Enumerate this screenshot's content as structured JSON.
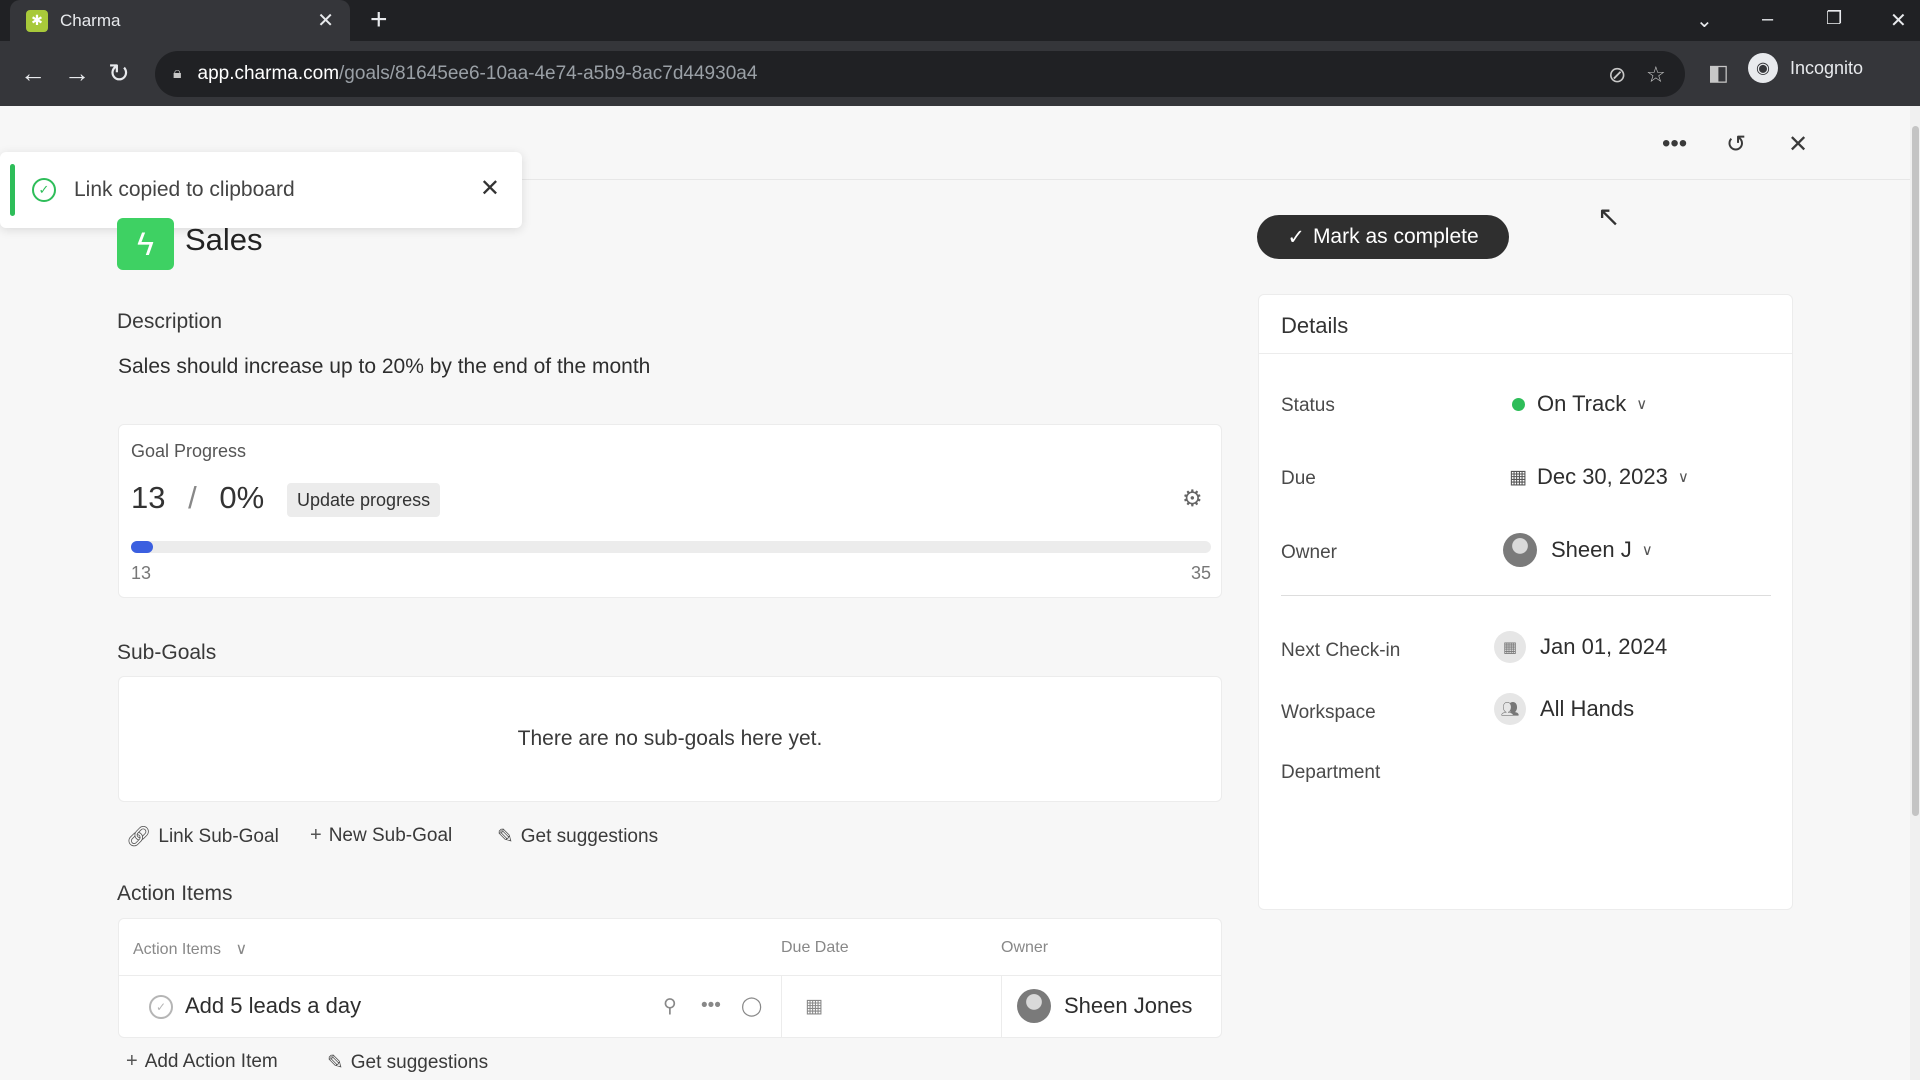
{
  "browser": {
    "tab_title": "Charma",
    "url_host": "app.charma.com",
    "url_path": "/goals/81645ee6-10aa-4e74-a5b9-8ac7d44930a4",
    "profile_label": "Incognito"
  },
  "toast": {
    "message": "Link copied to clipboard"
  },
  "goal": {
    "title": "Sales",
    "icon": "lightning-icon",
    "description_label": "Description",
    "description": "Sales should increase up to 20% by the end of the month"
  },
  "progress": {
    "title": "Goal Progress",
    "current": "13",
    "separator": "/",
    "percent": "0%",
    "update_label": "Update progress",
    "min_label": "13",
    "max_label": "35",
    "fill_fraction": 0.0
  },
  "subgoals": {
    "heading": "Sub-Goals",
    "empty_message": "There are no sub-goals here yet.",
    "actions": {
      "link": "Link Sub-Goal",
      "new": "New Sub-Goal",
      "suggest": "Get suggestions"
    }
  },
  "action_items": {
    "heading": "Action Items",
    "columns": {
      "name": "Action Items",
      "due": "Due Date",
      "owner": "Owner"
    },
    "rows": [
      {
        "name": "Add 5 leads a day",
        "owner": "Sheen Jones"
      }
    ],
    "add_label": "Add Action Item",
    "suggest_label": "Get suggestions"
  },
  "mark_complete_label": "Mark as complete",
  "details": {
    "title": "Details",
    "status_label": "Status",
    "status_value": "On Track",
    "status_color": "#2ebd59",
    "due_label": "Due",
    "due_value": "Dec 30, 2023",
    "owner_label": "Owner",
    "owner_value": "Sheen J",
    "checkin_label": "Next Check-in",
    "checkin_value": "Jan 01, 2024",
    "workspace_label": "Workspace",
    "workspace_value": "All Hands",
    "department_label": "Department"
  },
  "colors": {
    "accent_green": "#3ed163",
    "progress_blue": "#3b5fe0",
    "dark_button": "#2f2f2f"
  }
}
